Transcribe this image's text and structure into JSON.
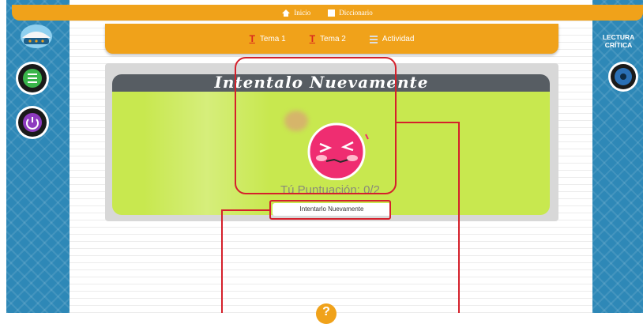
{
  "topnav": {
    "home_label": "Inicio",
    "dictionary_label": "Diccionario"
  },
  "subnav": {
    "tema1_label": "Tema 1",
    "tema2_label": "Tema 2",
    "actividad_label": "Actividad"
  },
  "result": {
    "title": "Intentalo Nuevamente",
    "score_text": "Tú Puntuación: 0/2",
    "retry_button_label": "Intentarlo Nuevamente"
  },
  "right_sidebar": {
    "lectura_line1": "LECTURA",
    "lectura_line2": "CRÍTICA"
  },
  "help": {
    "label": "?"
  },
  "colors": {
    "accent": "#f0a21a",
    "sidebar": "#2e88b7",
    "panel_body": "#c8e84f",
    "highlight": "#d5202b",
    "face": "#ef2d71"
  }
}
